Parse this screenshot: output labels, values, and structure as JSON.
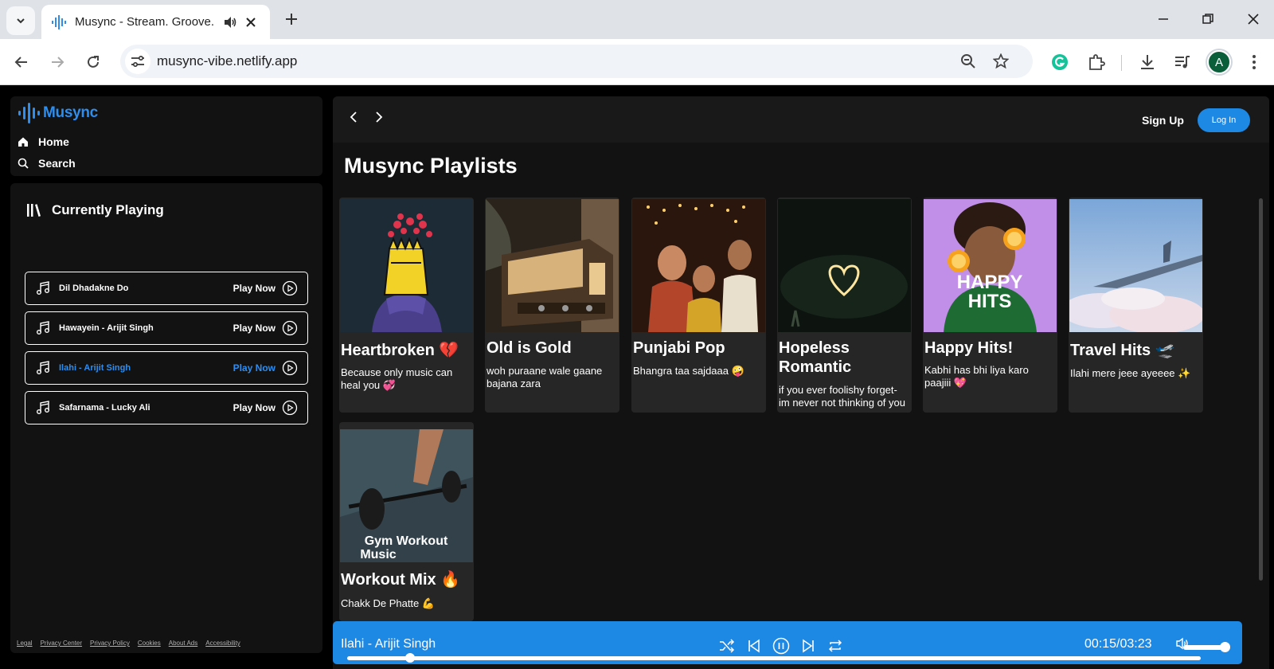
{
  "browser": {
    "tab_title": "Musync - Stream. Groove. R",
    "url": "musync-vibe.netlify.app",
    "profile_initial": "A"
  },
  "sidebar": {
    "logo_text": "Musync",
    "nav": [
      {
        "label": "Home",
        "icon": "home-icon"
      },
      {
        "label": "Search",
        "icon": "search-icon"
      }
    ],
    "currently_playing_label": "Currently Playing",
    "songs": [
      {
        "name": "Dil Dhadakne Do",
        "action": "Play Now",
        "active": false
      },
      {
        "name": "Hawayein - Arijit Singh",
        "action": "Play Now",
        "active": false
      },
      {
        "name": "Ilahi - Arijit Singh",
        "action": "Play Now",
        "active": true
      },
      {
        "name": "Safarnama - Lucky Ali",
        "action": "Play Now",
        "active": false
      }
    ],
    "footer_links": [
      "Legal",
      "Privacy Center",
      "Privacy Policy",
      "Cookies",
      "About Ads",
      "Accessibility"
    ]
  },
  "header": {
    "signup_label": "Sign Up",
    "login_label": "Log In"
  },
  "main": {
    "section_title": "Musync Playlists",
    "playlists": [
      {
        "title": "Heartbroken 💔",
        "description": "Because only music can heal you 💞"
      },
      {
        "title": "Old is Gold",
        "description": "woh puraane wale gaane bajana zara"
      },
      {
        "title": "Punjabi Pop",
        "description": "Bhangra taa sajdaaa 🤪"
      },
      {
        "title": "Hopeless Romantic",
        "description": "if you ever foolishy forget- im never not thinking of you"
      },
      {
        "title": "Happy Hits!",
        "description": "Kabhi has bhi liya karo paajiii 💖",
        "image_text": "HAPPY HITS"
      },
      {
        "title": "Travel Hits 🛫",
        "description": "Ilahi mere jeee ayeeee ✨"
      },
      {
        "title": "Workout Mix 🔥",
        "description": "Chakk De Phatte 💪",
        "image_text": "Gym Workout Music"
      }
    ]
  },
  "player": {
    "track": "Ilahi - Arijit Singh",
    "time": "00:15/03:23",
    "progress_fraction": 0.074,
    "volume_fraction": 0.9
  }
}
